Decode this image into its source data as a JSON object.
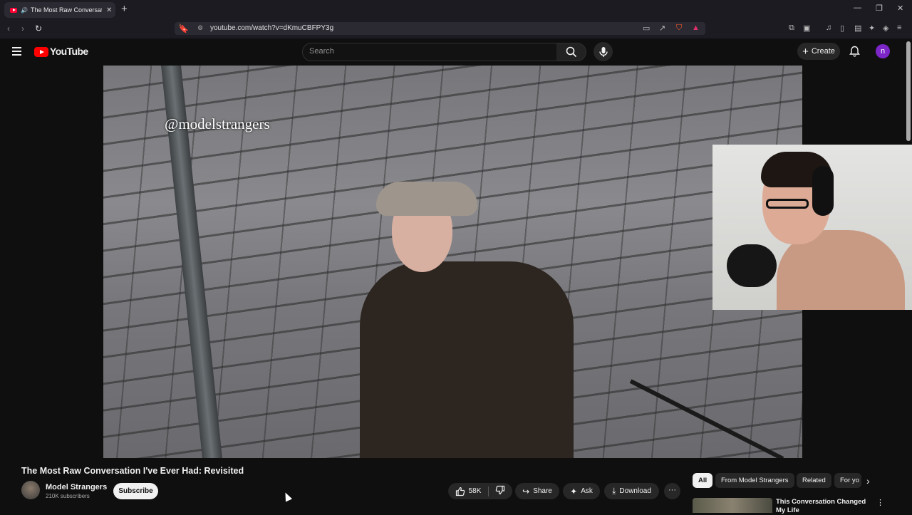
{
  "browser": {
    "tab_title": "The Most Raw Conversation",
    "tab_close": "✕",
    "new_tab": "+",
    "url": "youtube.com/watch?v=dKmuCBFPY3g",
    "window_min": "—",
    "window_max": "❐",
    "window_close": "✕"
  },
  "youtube": {
    "logo_text": "YouTube",
    "search_placeholder": "Search",
    "create_label": "Create",
    "avatar_letter": "n"
  },
  "video": {
    "watermark": "@modelstrangers",
    "title": "The Most Raw Conversation I've Ever Had: Revisited"
  },
  "channel": {
    "name": "Model Strangers",
    "subscribers": "210K subscribers",
    "subscribe_label": "Subscribe"
  },
  "actions": {
    "likes": "58K",
    "share": "Share",
    "ask": "Ask",
    "download": "Download",
    "more": "···"
  },
  "chips": [
    "All",
    "From Model Strangers",
    "Related",
    "For yo"
  ],
  "recommendation": {
    "title": "This Conversation Changed My Life"
  },
  "colors": {
    "brand_red": "#ff0000",
    "avatar_purple": "#7c26c8",
    "background": "#0f0f0f"
  }
}
